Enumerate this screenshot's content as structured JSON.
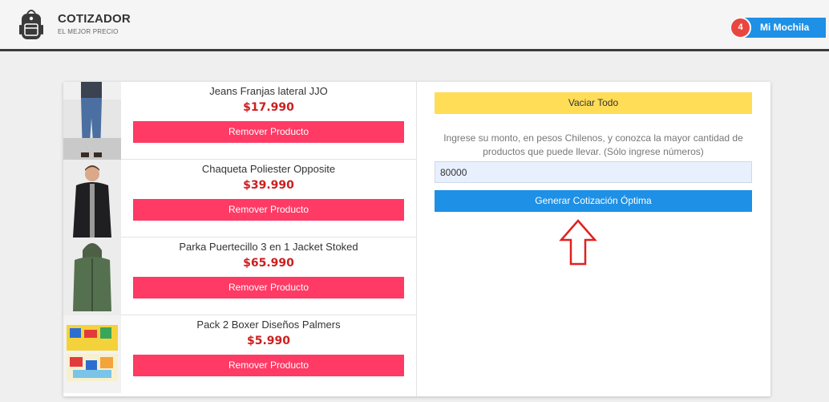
{
  "brand": {
    "title": "COTIZADOR",
    "subtitle": "EL MEJOR PRECIO",
    "icon": "backpack-icon"
  },
  "cart": {
    "count": "4",
    "label": "Mi Mochila"
  },
  "products": [
    {
      "name": "Jeans Franjas lateral JJO",
      "price": "$17.990",
      "remove_label": "Remover Producto",
      "image": "jeans-photo"
    },
    {
      "name": "Chaqueta Poliester Opposite",
      "price": "$39.990",
      "remove_label": "Remover Producto",
      "image": "jacket-photo"
    },
    {
      "name": "Parka Puertecillo 3 en 1 Jacket Stoked",
      "price": "$65.990",
      "remove_label": "Remover Producto",
      "image": "parka-photo"
    },
    {
      "name": "Pack 2 Boxer Diseños Palmers",
      "price": "$5.990",
      "remove_label": "Remover Producto",
      "image": "boxer-photo"
    }
  ],
  "quote": {
    "clear_label": "Vaciar Todo",
    "instructions": "Ingrese su monto, en pesos Chilenos, y conozca la mayor cantidad de productos que puede llevar. (Sólo ingrese números)",
    "amount_value": "80000",
    "generate_label": "Generar Cotización Óptima"
  },
  "colors": {
    "accent_blue": "#1e90e6",
    "remove_pink": "#ff3a64",
    "clear_yellow": "#ffdd57",
    "price_red": "#cc1f1f",
    "badge_red": "#e8463f",
    "arrow_red": "#e02020"
  }
}
